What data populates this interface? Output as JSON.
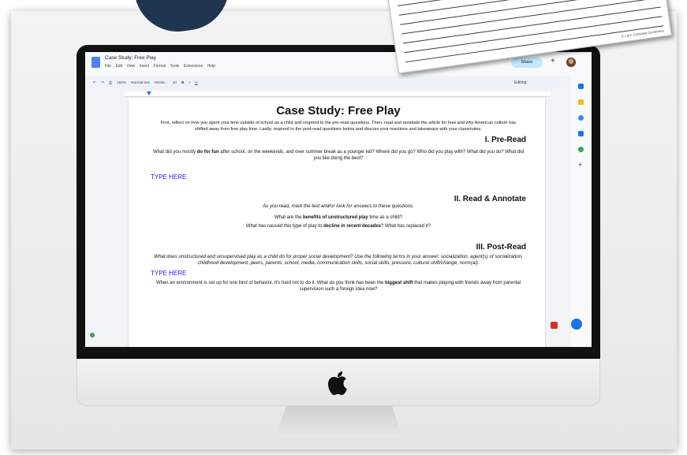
{
  "window": {
    "doc_title": "Case Study: Free Play",
    "menu": [
      "File",
      "Edit",
      "View",
      "Insert",
      "Format",
      "Tools",
      "Extensions",
      "Help"
    ],
    "share_label": "Share",
    "zoom": "150%",
    "style": "Normal text",
    "font": "Monts...",
    "font_size": "20",
    "mode": "Editing"
  },
  "document": {
    "title": "Case Study: Free Play",
    "intro": "First, reflect on how you spent your time outside of school as a child and respond to the pre-read questions. Then, read and annotate the article for how and why American culture has shifted away from free play time. Lastly, respond to the post-read questions below and discuss your reactions and takeaways with your classmates.",
    "sections": [
      {
        "heading": "I.   Pre-Read",
        "question_parts": [
          "What did you mostly ",
          "do for fun",
          " after school, on the weekends, and over summer break as a younger kid? Where did you go? Who did you play with? What did you do? What did you like doing the best?"
        ],
        "type_here": "TYPE HERE"
      },
      {
        "heading": "II. Read & Annotate",
        "instruction": "As you read, mark the text and/or look for answers to these questions.",
        "q1_parts": [
          "What are the ",
          "benefits of unstructured play",
          " time as a child?"
        ],
        "q2_parts": [
          "What has caused this type of play to ",
          "decline in recent decades",
          "? What has replaced it?"
        ]
      },
      {
        "heading": "III. Post-Read",
        "instruction": "What does unstructured and unsupervised play as a child do for proper social development? Use the following terms in your answer: socialization, agent(s) of socialization, childhood development, peers, parents, school, media, communication skills, social skills, pressure, cultural shift/change, norm(al).",
        "type_here": "TYPE HERE",
        "q_parts": [
          "When an environment is set up for one kind of behavior, it's hard not to do it. What do you think has been the ",
          "biggest shift",
          " that makes playing with friends away from parental supervision such a foreign idea now?"
        ]
      }
    ]
  },
  "paper": {
    "brand": "© Let's Cultivate Greatness"
  },
  "icons": [
    "docs-icon",
    "star-icon",
    "share-icon",
    "avatar",
    "apple-logo-icon"
  ],
  "colors": {
    "type_here": "#2b18e8",
    "share_bg": "#c2e7ff",
    "navy_blob": "#1f3550"
  }
}
